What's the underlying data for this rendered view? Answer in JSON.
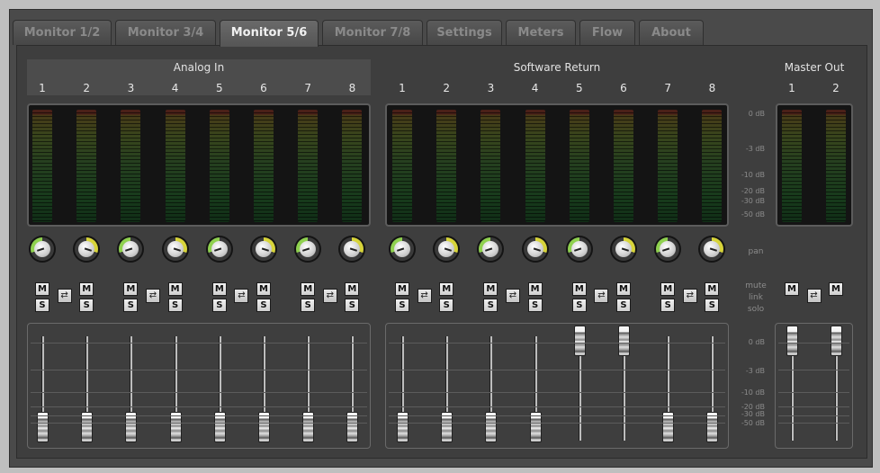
{
  "tabs": [
    "Monitor 1/2",
    "Monitor 3/4",
    "Monitor 5/6",
    "Monitor 7/8",
    "Settings",
    "Meters",
    "Flow",
    "About"
  ],
  "active_tab": "Monitor 5/6",
  "groups": {
    "analog": {
      "title": "Analog In",
      "channels": [
        "1",
        "2",
        "3",
        "4",
        "5",
        "6",
        "7",
        "8"
      ]
    },
    "software": {
      "title": "Software Return",
      "channels": [
        "1",
        "2",
        "3",
        "4",
        "5",
        "6",
        "7",
        "8"
      ]
    },
    "master": {
      "title": "Master Out",
      "channels": [
        "1",
        "2"
      ]
    }
  },
  "meter_scale": [
    "0 dB",
    "-3 dB",
    "-10 dB",
    "-20 dB",
    "-30 dB",
    "-50 dB"
  ],
  "fader_scale": [
    "0 dB",
    "-3 dB",
    "-10 dB",
    "-20 dB",
    "-30 dB",
    "-50 dB"
  ],
  "side_labels": {
    "pan": "pan",
    "mute": "mute",
    "link": "link",
    "solo": "solo"
  },
  "buttons": {
    "mute": "M",
    "solo": "S",
    "link": "⇄"
  },
  "pan": {
    "analog": [
      -0.8,
      0.8,
      -0.8,
      0.8,
      -0.8,
      0.8,
      -0.8,
      0.8
    ],
    "software": [
      -0.8,
      0.8,
      -0.8,
      0.8,
      -0.8,
      0.8,
      -0.8,
      0.8
    ]
  },
  "faders": {
    "analog": [
      -50,
      -50,
      -50,
      -50,
      -50,
      -50,
      -50,
      -50
    ],
    "software": [
      -50,
      -50,
      -50,
      -50,
      0,
      0,
      -50,
      -50
    ],
    "master": [
      0,
      0
    ]
  },
  "colors": {
    "pan_arc": "#8fd14f",
    "pan_arc_alt": "#d7d43a"
  }
}
